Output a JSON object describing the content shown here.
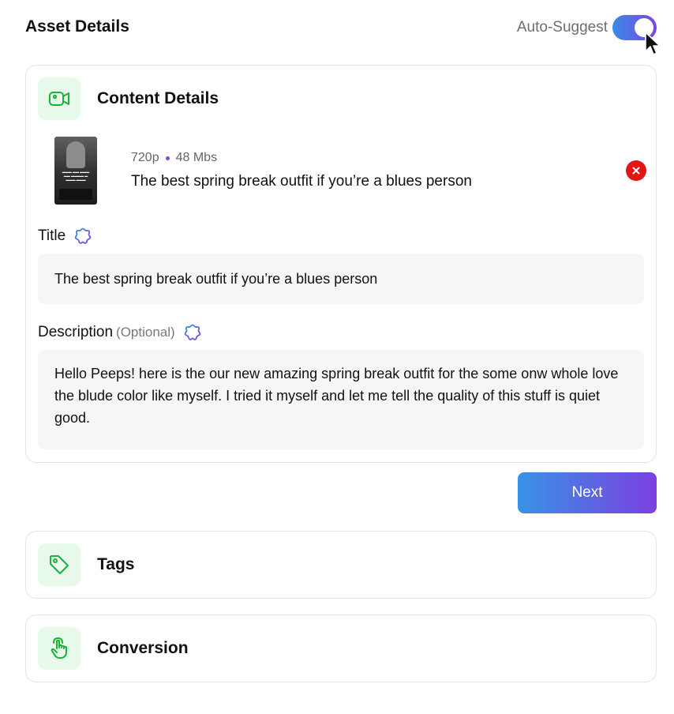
{
  "header": {
    "title": "Asset Details",
    "auto_suggest_label": "Auto-Suggest",
    "auto_suggest_on": true
  },
  "content_details": {
    "title": "Content Details",
    "media": {
      "resolution": "720p",
      "size": "48 Mbs",
      "title": "The best spring break outfit if you’re a blues person"
    },
    "fields": {
      "title_label": "Title",
      "title_value": "The best spring break outfit if you’re a blues person",
      "description_label": "Description",
      "description_optional": "(Optional)",
      "description_value": "Hello Peeps! here is the our new amazing spring break outfit for the some onw whole love the blude color like myself. I tried it myself and let me tell the quality of this stuff is quiet good."
    }
  },
  "actions": {
    "next_label": "Next"
  },
  "sections": {
    "tags_title": "Tags",
    "conversion_title": "Conversion"
  },
  "colors": {
    "accent_start": "#3893e6",
    "accent_end": "#7c3fe0",
    "icon_bg": "#e6f9ea",
    "icon_green": "#19b33a",
    "remove_red": "#e31616"
  },
  "icons": {
    "content": "video-camera-icon",
    "tags": "tag-icon",
    "conversion": "tap-hand-icon",
    "ai": "sparkle-badge-icon",
    "remove": "close-icon"
  }
}
